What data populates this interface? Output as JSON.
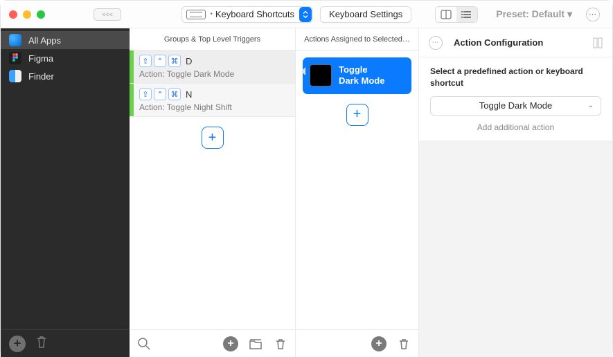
{
  "toolbar": {
    "dropdown_label": "Keyboard Shortcuts",
    "settings_label": "Keyboard Settings",
    "preset_label": "Preset: Default ▾"
  },
  "sidebar": {
    "items": [
      {
        "label": "All Apps"
      },
      {
        "label": "Figma"
      },
      {
        "label": "Finder"
      }
    ]
  },
  "columns": {
    "groups_header": "Groups & Top Level Triggers",
    "actions_header": "Actions Assigned to Selected…",
    "config_header": "Action Configuration"
  },
  "triggers": [
    {
      "keys": [
        "⇧",
        "⌃",
        "⌘"
      ],
      "letter": "D",
      "action": "Action: Toggle Dark Mode"
    },
    {
      "keys": [
        "⇧",
        "⌃",
        "⌘"
      ],
      "letter": "N",
      "action": "Action: Toggle Night Shift"
    }
  ],
  "action_card": {
    "line1": "Toggle",
    "line2": "Dark Mode"
  },
  "config": {
    "help": "Select a predefined action or keyboard shortcut",
    "select_value": "Toggle Dark Mode",
    "add_link": "Add additional action"
  }
}
